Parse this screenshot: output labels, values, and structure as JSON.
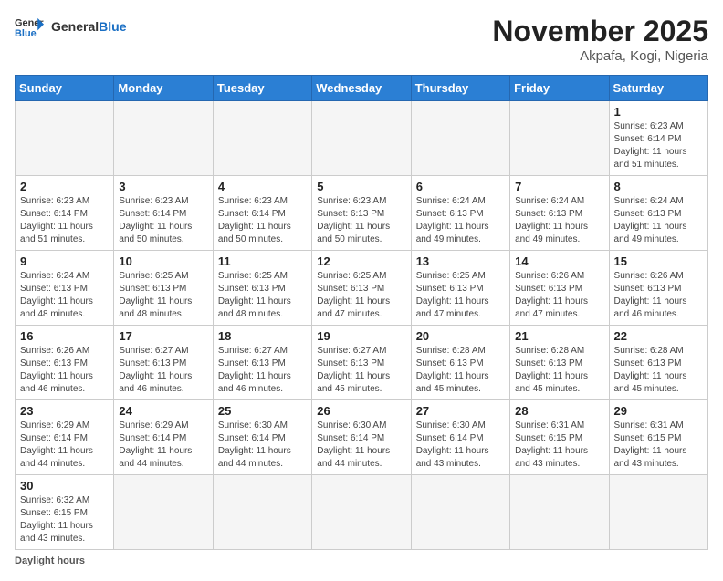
{
  "header": {
    "logo_general": "General",
    "logo_blue": "Blue",
    "month_title": "November 2025",
    "location": "Akpafa, Kogi, Nigeria"
  },
  "weekdays": [
    "Sunday",
    "Monday",
    "Tuesday",
    "Wednesday",
    "Thursday",
    "Friday",
    "Saturday"
  ],
  "days": [
    {
      "date": "",
      "info": ""
    },
    {
      "date": "",
      "info": ""
    },
    {
      "date": "",
      "info": ""
    },
    {
      "date": "",
      "info": ""
    },
    {
      "date": "",
      "info": ""
    },
    {
      "date": "",
      "info": ""
    },
    {
      "date": "1",
      "info": "Sunrise: 6:23 AM\nSunset: 6:14 PM\nDaylight: 11 hours and 51 minutes."
    },
    {
      "date": "2",
      "info": "Sunrise: 6:23 AM\nSunset: 6:14 PM\nDaylight: 11 hours and 51 minutes."
    },
    {
      "date": "3",
      "info": "Sunrise: 6:23 AM\nSunset: 6:14 PM\nDaylight: 11 hours and 50 minutes."
    },
    {
      "date": "4",
      "info": "Sunrise: 6:23 AM\nSunset: 6:14 PM\nDaylight: 11 hours and 50 minutes."
    },
    {
      "date": "5",
      "info": "Sunrise: 6:23 AM\nSunset: 6:13 PM\nDaylight: 11 hours and 50 minutes."
    },
    {
      "date": "6",
      "info": "Sunrise: 6:24 AM\nSunset: 6:13 PM\nDaylight: 11 hours and 49 minutes."
    },
    {
      "date": "7",
      "info": "Sunrise: 6:24 AM\nSunset: 6:13 PM\nDaylight: 11 hours and 49 minutes."
    },
    {
      "date": "8",
      "info": "Sunrise: 6:24 AM\nSunset: 6:13 PM\nDaylight: 11 hours and 49 minutes."
    },
    {
      "date": "9",
      "info": "Sunrise: 6:24 AM\nSunset: 6:13 PM\nDaylight: 11 hours and 48 minutes."
    },
    {
      "date": "10",
      "info": "Sunrise: 6:25 AM\nSunset: 6:13 PM\nDaylight: 11 hours and 48 minutes."
    },
    {
      "date": "11",
      "info": "Sunrise: 6:25 AM\nSunset: 6:13 PM\nDaylight: 11 hours and 48 minutes."
    },
    {
      "date": "12",
      "info": "Sunrise: 6:25 AM\nSunset: 6:13 PM\nDaylight: 11 hours and 47 minutes."
    },
    {
      "date": "13",
      "info": "Sunrise: 6:25 AM\nSunset: 6:13 PM\nDaylight: 11 hours and 47 minutes."
    },
    {
      "date": "14",
      "info": "Sunrise: 6:26 AM\nSunset: 6:13 PM\nDaylight: 11 hours and 47 minutes."
    },
    {
      "date": "15",
      "info": "Sunrise: 6:26 AM\nSunset: 6:13 PM\nDaylight: 11 hours and 46 minutes."
    },
    {
      "date": "16",
      "info": "Sunrise: 6:26 AM\nSunset: 6:13 PM\nDaylight: 11 hours and 46 minutes."
    },
    {
      "date": "17",
      "info": "Sunrise: 6:27 AM\nSunset: 6:13 PM\nDaylight: 11 hours and 46 minutes."
    },
    {
      "date": "18",
      "info": "Sunrise: 6:27 AM\nSunset: 6:13 PM\nDaylight: 11 hours and 46 minutes."
    },
    {
      "date": "19",
      "info": "Sunrise: 6:27 AM\nSunset: 6:13 PM\nDaylight: 11 hours and 45 minutes."
    },
    {
      "date": "20",
      "info": "Sunrise: 6:28 AM\nSunset: 6:13 PM\nDaylight: 11 hours and 45 minutes."
    },
    {
      "date": "21",
      "info": "Sunrise: 6:28 AM\nSunset: 6:13 PM\nDaylight: 11 hours and 45 minutes."
    },
    {
      "date": "22",
      "info": "Sunrise: 6:28 AM\nSunset: 6:13 PM\nDaylight: 11 hours and 45 minutes."
    },
    {
      "date": "23",
      "info": "Sunrise: 6:29 AM\nSunset: 6:14 PM\nDaylight: 11 hours and 44 minutes."
    },
    {
      "date": "24",
      "info": "Sunrise: 6:29 AM\nSunset: 6:14 PM\nDaylight: 11 hours and 44 minutes."
    },
    {
      "date": "25",
      "info": "Sunrise: 6:30 AM\nSunset: 6:14 PM\nDaylight: 11 hours and 44 minutes."
    },
    {
      "date": "26",
      "info": "Sunrise: 6:30 AM\nSunset: 6:14 PM\nDaylight: 11 hours and 44 minutes."
    },
    {
      "date": "27",
      "info": "Sunrise: 6:30 AM\nSunset: 6:14 PM\nDaylight: 11 hours and 43 minutes."
    },
    {
      "date": "28",
      "info": "Sunrise: 6:31 AM\nSunset: 6:15 PM\nDaylight: 11 hours and 43 minutes."
    },
    {
      "date": "29",
      "info": "Sunrise: 6:31 AM\nSunset: 6:15 PM\nDaylight: 11 hours and 43 minutes."
    },
    {
      "date": "30",
      "info": "Sunrise: 6:32 AM\nSunset: 6:15 PM\nDaylight: 11 hours and 43 minutes."
    },
    {
      "date": "",
      "info": ""
    },
    {
      "date": "",
      "info": ""
    },
    {
      "date": "",
      "info": ""
    },
    {
      "date": "",
      "info": ""
    },
    {
      "date": "",
      "info": ""
    },
    {
      "date": "",
      "info": ""
    }
  ],
  "footer": {
    "daylight_label": "Daylight hours"
  }
}
